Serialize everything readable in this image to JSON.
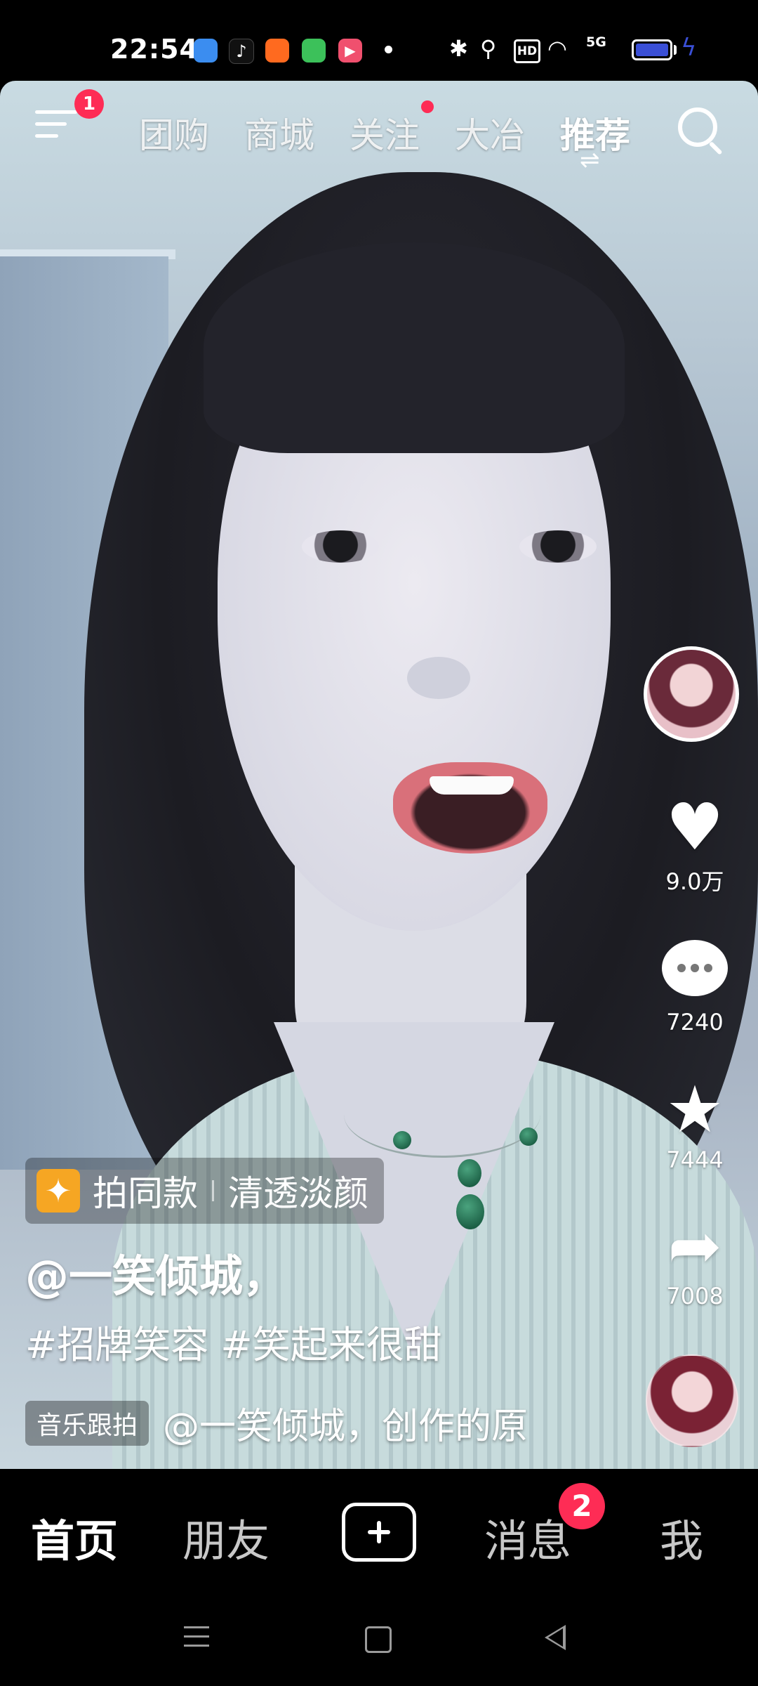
{
  "status_bar": {
    "time": "22:54",
    "app_icons": [
      {
        "name": "blue-app-icon",
        "color": "#3b8df0"
      },
      {
        "name": "douyin-icon",
        "color": "#111111"
      },
      {
        "name": "orange-app-icon",
        "color": "#ff6a1f"
      },
      {
        "name": "chat-app-icon",
        "color": "#3cc15a"
      },
      {
        "name": "video-app-icon",
        "color": "#f0506e"
      }
    ],
    "hd": "HD",
    "network": "5G",
    "battery_level": 1.0
  },
  "top_nav": {
    "menu_badge": "1",
    "tabs": [
      {
        "label": "团购",
        "active": false
      },
      {
        "label": "商城",
        "active": false
      },
      {
        "label": "关注",
        "active": false,
        "dot": true
      },
      {
        "label": "大冶",
        "active": false
      },
      {
        "label": "推荐",
        "active": true
      }
    ],
    "refresh_glyph": "⇌"
  },
  "rail": {
    "likes": "9.0万",
    "comments": "7240",
    "favorites": "7444",
    "shares": "7008"
  },
  "video_info": {
    "effect_label": "拍同款",
    "effect_name": "清透淡颜",
    "author": "@一笑倾城，",
    "hashtags": "#招牌笑容 #笑起来很甜",
    "music_chip": "音乐跟拍",
    "music_text": "@一笑倾城，创作的原"
  },
  "bottom_nav": {
    "home": "首页",
    "friends": "朋友",
    "messages": "消息",
    "messages_badge": "2",
    "me": "我"
  },
  "colors": {
    "accent": "#fe2c55",
    "effect_icon": "#f6a623"
  }
}
